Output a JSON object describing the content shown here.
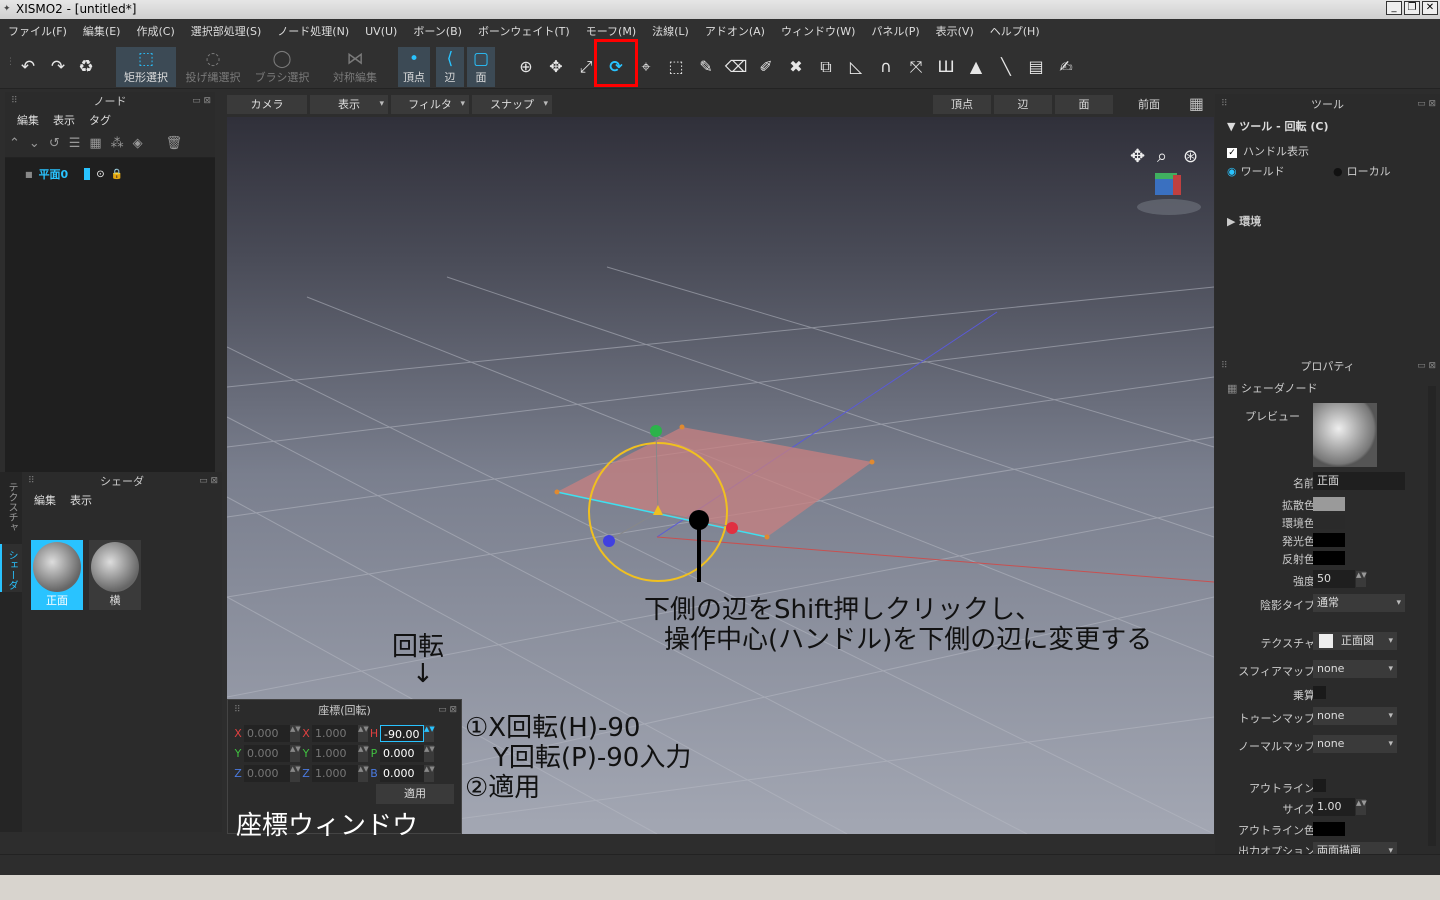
{
  "window": {
    "title": "XISMO2 - [untitled*]",
    "controls": [
      "_",
      "❐",
      "✕"
    ]
  },
  "menu": [
    "ファイル(F)",
    "編集(E)",
    "作成(C)",
    "選択部処理(S)",
    "ノード処理(N)",
    "UV(U)",
    "ボーン(B)",
    "ボーンウェイト(T)",
    "モーフ(M)",
    "法線(L)",
    "アドオン(A)",
    "ウィンドウ(W)",
    "パネル(P)",
    "表示(V)",
    "ヘルプ(H)"
  ],
  "toolbar": {
    "rect_select": "矩形選択",
    "lasso_select": "投げ縄選択",
    "brush_select": "ブラシ選択",
    "symmetric_edit": "対称編集",
    "vertex": "頂点",
    "edge": "辺",
    "face": "面"
  },
  "node_panel": {
    "title": "ノード",
    "menu": [
      "編集",
      "表示",
      "タグ"
    ],
    "item": "平面0"
  },
  "shader_panel": {
    "title": "シェーダ",
    "menu": [
      "編集",
      "表示"
    ],
    "items": [
      "正面",
      "横"
    ],
    "side_tabs": [
      "テクスチャ",
      "シェーダ"
    ]
  },
  "viewport_bar": {
    "camera": "カメラ",
    "display": "表示",
    "filter": "フィルタ",
    "snap": "スナップ",
    "vertex": "頂点",
    "edge": "辺",
    "face": "面",
    "view": "前面"
  },
  "annotations": {
    "edge_line1": "下側の辺をShift押しクリックし、",
    "edge_line2": "操作中心(ハンドル)を下側の辺に変更する",
    "rotate": "回転",
    "arrow": "↓",
    "step1a": "①X回転(H)-90",
    "step1b": "Y回転(P)-90入力",
    "step2": "②適用",
    "coord_window": "座標ウィンドウ"
  },
  "coord_panel": {
    "title": "座標(回転)",
    "x_label": "X",
    "y_label": "Y",
    "z_label": "Z",
    "h_label": "H",
    "p_label": "P",
    "b_label": "B",
    "pos_x": "0.000",
    "pos_y": "0.000",
    "pos_z": "0.000",
    "scale_x": "1.000",
    "scale_y": "1.000",
    "scale_z": "1.000",
    "h_value": "-90.00",
    "p_value": "0.000",
    "b_value": "0.000",
    "apply": "適用"
  },
  "tool_panel": {
    "title": "ツール",
    "section": "ツール - 回転 (C)",
    "handle_display": "ハンドル表示",
    "world": "ワールド",
    "local": "ローカル",
    "environment": "環境"
  },
  "property_panel": {
    "title": "プロパティ",
    "section": "シェーダノード",
    "preview": "プレビュー",
    "name_label": "名前",
    "name_value": "正面",
    "diffuse": "拡散色",
    "ambient": "環境色",
    "emissive": "発光色",
    "reflect": "反射色",
    "strength_label": "強度",
    "strength_value": "50",
    "shading_label": "陰影タイプ",
    "shading_value": "通常",
    "texture_label": "テクスチャ",
    "texture_value": "正面図",
    "sphere_label": "スフィアマップ",
    "sphere_value": "none",
    "multiply_label": "乗算",
    "toon_label": "トゥーンマップ",
    "toon_value": "none",
    "normal_label": "ノーマルマップ",
    "normal_value": "none",
    "outline_label": "アウトライン",
    "size_label": "サイズ",
    "size_value": "1.00",
    "outline_color_label": "アウトライン色",
    "output_label": "出力オプション",
    "output_value": "両面描画"
  },
  "colors": {
    "accent": "#29c3ff",
    "highlight_box": "#ff0000",
    "diffuse": "#9a9a9a",
    "ambient": "#2a2a2a",
    "emissive": "#000000",
    "reflect": "#000000"
  }
}
